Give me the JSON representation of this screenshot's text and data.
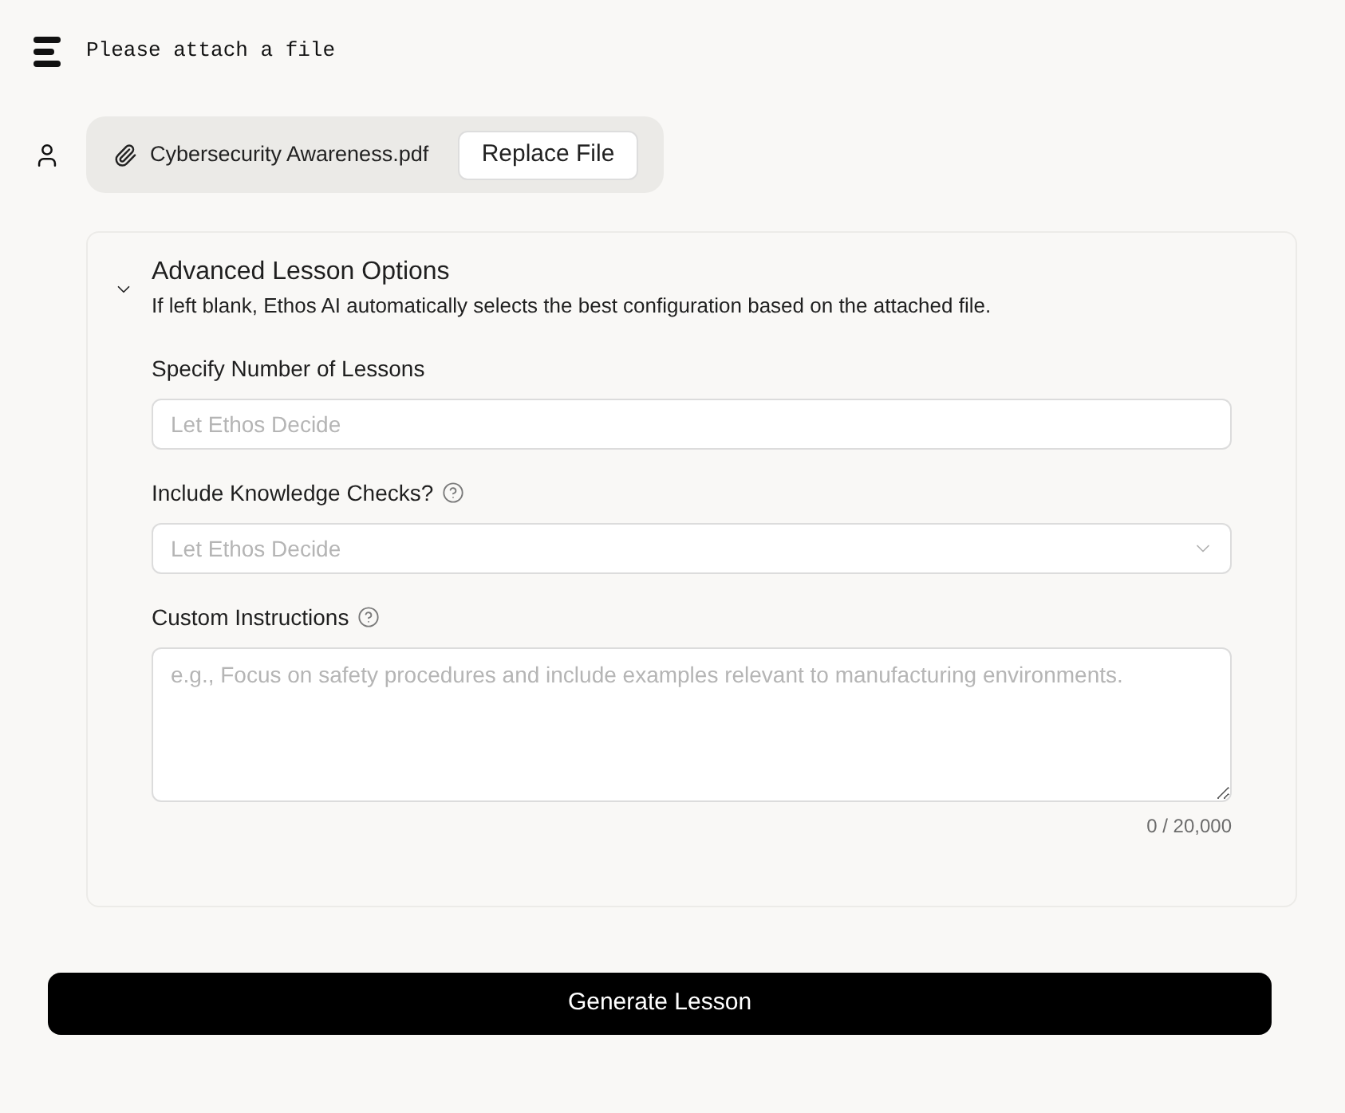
{
  "header": {
    "title": "Please attach a file"
  },
  "attachment": {
    "file_name": "Cybersecurity Awareness.pdf",
    "button": "Replace File"
  },
  "options": {
    "title": "Advanced Lesson Options",
    "expanded": true,
    "description": "If left blank, Ethos AI automatically selects the best configuration based on the attached file.",
    "fields": [
      {
        "kind": "input",
        "label": "Specify Number of Lessons",
        "placeholder": "Let Ethos Decide",
        "help": false
      },
      {
        "kind": "select",
        "label": "Include Knowledge Checks?",
        "placeholder": "Let Ethos Decide",
        "help": true
      },
      {
        "kind": "textarea",
        "label": "Custom Instructions",
        "placeholder": "e.g., Focus on safety procedures and include examples relevant to manufacturing environments.",
        "help": true,
        "counter": "0 / 20,000"
      }
    ]
  },
  "submit": {
    "label": "Generate Lesson"
  }
}
